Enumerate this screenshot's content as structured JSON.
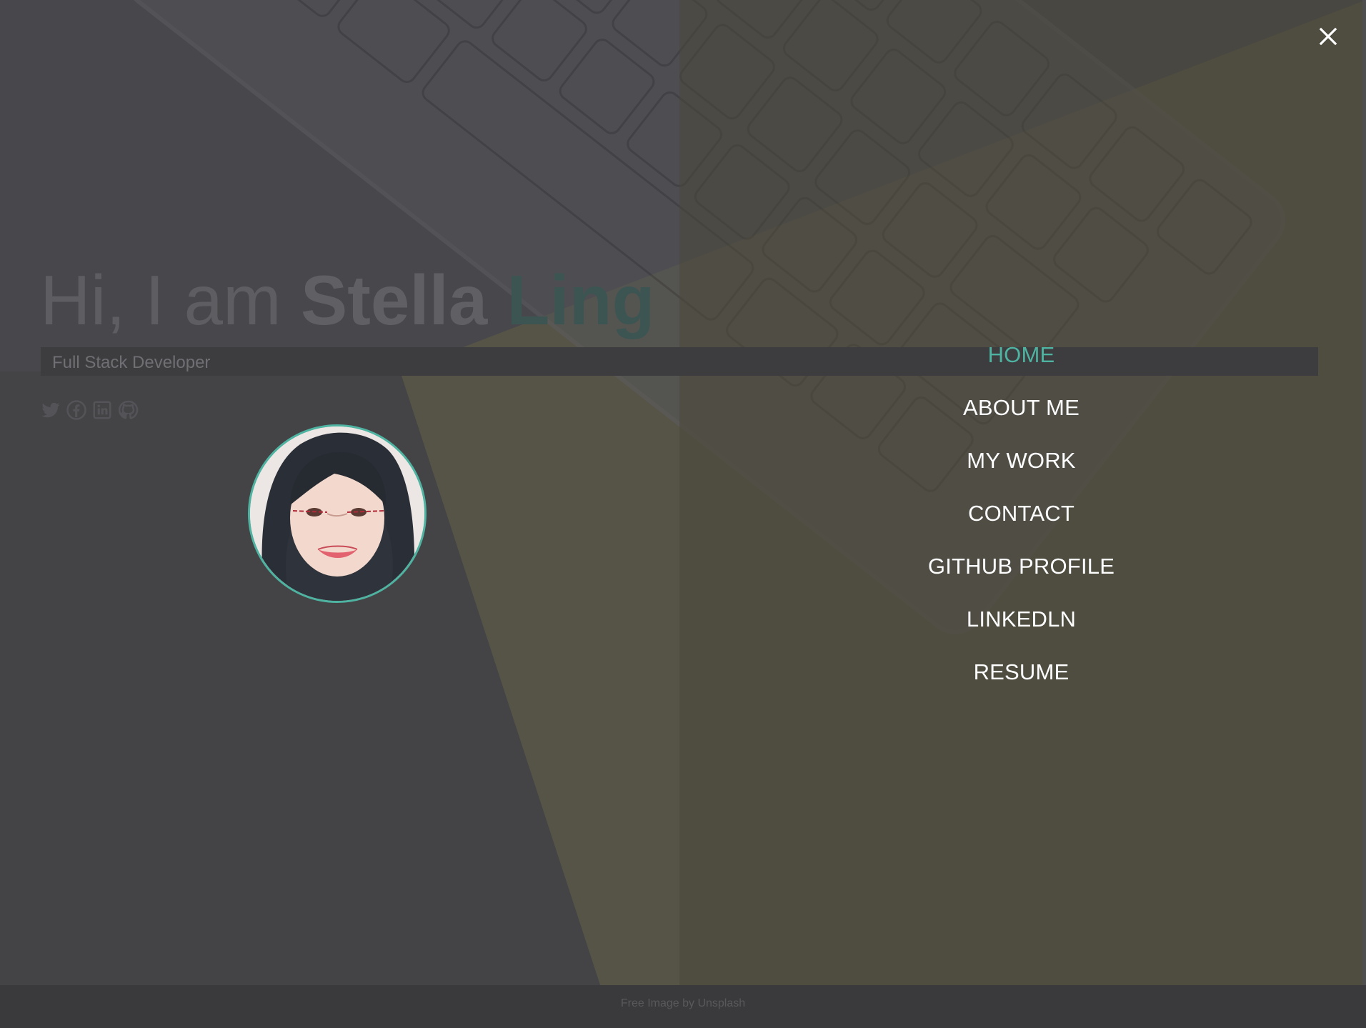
{
  "hero": {
    "greeting": "Hi, I am ",
    "first_name": "Stella",
    "last_name": "Ling",
    "subtitle": "Full Stack Developer"
  },
  "social_icons": [
    "twitter-icon",
    "facebook-icon",
    "linkedin-icon",
    "github-icon"
  ],
  "menu": {
    "items": [
      {
        "label": "HOME",
        "active": true
      },
      {
        "label": "ABOUT ME",
        "active": false
      },
      {
        "label": "MY WORK",
        "active": false
      },
      {
        "label": "CONTACT",
        "active": false
      },
      {
        "label": "GITHUB PROFILE",
        "active": false
      },
      {
        "label": "LINKEDLN",
        "active": false
      },
      {
        "label": "RESUME",
        "active": false
      }
    ],
    "close_icon": "close-icon"
  },
  "footer": {
    "credit": "Free Image by Unsplash"
  },
  "colors": {
    "accent": "#4eb3a1",
    "overlay_left": "#46464a",
    "overlay_right": "#4b473b",
    "menu_text": "#ffffff"
  }
}
